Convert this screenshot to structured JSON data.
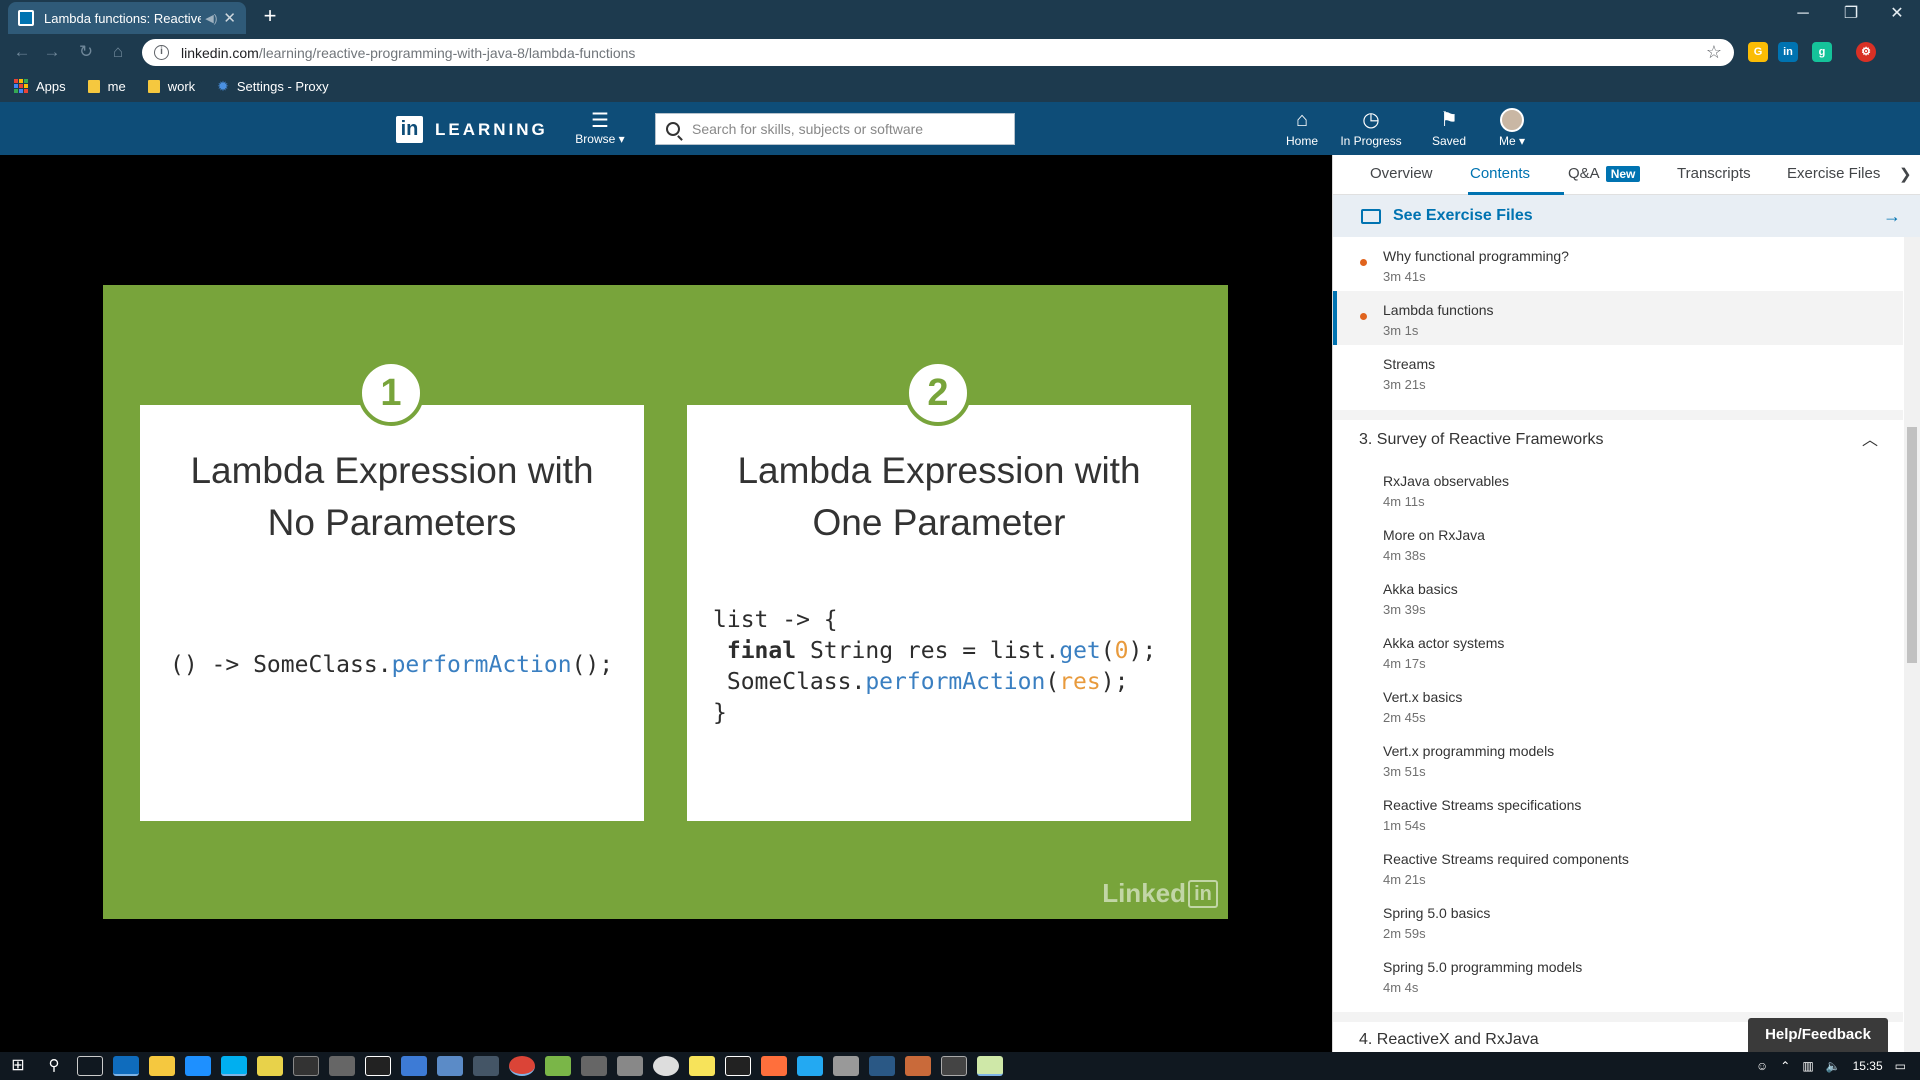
{
  "browser": {
    "tab_title": "Lambda functions: Reactive P",
    "url_host": "linkedin.com",
    "url_path": "/learning/reactive-programming-with-java-8/lambda-functions",
    "bookmarks": [
      {
        "label": "Apps"
      },
      {
        "label": "me"
      },
      {
        "label": "work"
      },
      {
        "label": "Settings - Proxy"
      }
    ]
  },
  "header": {
    "logo_word": "LEARNING",
    "browse_label": "Browse",
    "search_placeholder": "Search for skills, subjects or software",
    "nav": {
      "home": "Home",
      "in_progress": "In Progress",
      "saved": "Saved",
      "me": "Me"
    }
  },
  "slide": {
    "card1": {
      "number": "1",
      "title_line1": "Lambda Expression with",
      "title_line2": "No Parameters"
    },
    "card2": {
      "number": "2",
      "title_line1": "Lambda Expression with",
      "title_line2": "One Parameter"
    },
    "code1": {
      "a": "() -> SomeClass.",
      "method": "performAction",
      "b": "();"
    },
    "code2": {
      "l1": "list -> {",
      "l2_kw": "final",
      "l2_a": " String res = list.",
      "l2_method": "get",
      "l2_b": "(",
      "l2_num": "0",
      "l2_c": ");",
      "l3_a": " SomeClass.",
      "l3_method": "performAction",
      "l3_b": "(",
      "l3_arg": "res",
      "l3_c": ");",
      "l4": "}"
    },
    "watermark": "Linked",
    "watermark_box": "in"
  },
  "sidebar": {
    "tabs": {
      "overview": "Overview",
      "contents": "Contents",
      "qa": "Q&A",
      "qa_badge": "New",
      "transcripts": "Transcripts",
      "exercise_files": "Exercise Files"
    },
    "exercise_link": "See Exercise Files",
    "videos_top": [
      {
        "title": "Why functional programming?",
        "duration": "3m 41s"
      },
      {
        "title": "Lambda functions",
        "duration": "3m 1s"
      },
      {
        "title": "Streams",
        "duration": "3m 21s"
      }
    ],
    "chapter3": "3. Survey of Reactive Frameworks",
    "chapter3_videos": [
      {
        "title": "RxJava observables",
        "duration": "4m 11s"
      },
      {
        "title": "More on RxJava",
        "duration": "4m 38s"
      },
      {
        "title": "Akka basics",
        "duration": "3m 39s"
      },
      {
        "title": "Akka actor systems",
        "duration": "4m 17s"
      },
      {
        "title": "Vert.x basics",
        "duration": "2m 45s"
      },
      {
        "title": "Vert.x programming models",
        "duration": "3m 51s"
      },
      {
        "title": "Reactive Streams specifications",
        "duration": "1m 54s"
      },
      {
        "title": "Reactive Streams required components",
        "duration": "4m 21s"
      },
      {
        "title": "Spring 5.0 basics",
        "duration": "2m 59s"
      },
      {
        "title": "Spring 5.0 programming models",
        "duration": "4m 4s"
      }
    ],
    "chapter4": "4. ReactiveX and RxJava",
    "help": "Help/Feedback"
  },
  "taskbar": {
    "time": "15:35"
  },
  "colors": {
    "linkedin_blue": "#0073b1",
    "header_bg": "#0e4d78",
    "slide_green": "#78a43b",
    "progress_dot": "#e0631d"
  }
}
